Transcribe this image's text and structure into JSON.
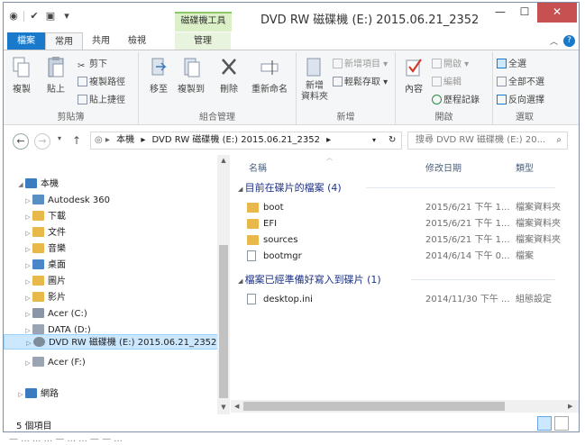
{
  "window": {
    "title": "DVD RW 磁碟機 (E:) 2015.06.21_2352",
    "context_tab_header": "磁碟機工具",
    "controls": {
      "minimize": "—",
      "maximize": "☐",
      "close": "✕"
    }
  },
  "ribbon_tabs": [
    {
      "label": "檔案"
    },
    {
      "label": "常用"
    },
    {
      "label": "共用"
    },
    {
      "label": "檢視"
    },
    {
      "label": "管理"
    }
  ],
  "ribbon": {
    "groups": {
      "clipboard": {
        "label": "剪貼簿",
        "copy": "複製",
        "paste": "貼上",
        "cut": "剪下",
        "copy_path": "複製路徑",
        "paste_shortcut": "貼上捷徑"
      },
      "organize": {
        "label": "組合管理",
        "move_to": "移至",
        "copy_to": "複製到",
        "delete": "刪除",
        "rename": "重新命名"
      },
      "new": {
        "label": "新增",
        "new_folder": "新增\n資料夾",
        "new_item": "新增項目 ▾",
        "easy_access": "輕鬆存取 ▾"
      },
      "open": {
        "label": "開啟",
        "properties": "內容",
        "open": "開啟 ▾",
        "edit": "編輯",
        "history": "歷程記錄"
      },
      "select": {
        "label": "選取",
        "select_all": "全選",
        "select_none": "全部不選",
        "invert": "反向選擇"
      }
    }
  },
  "address": {
    "segments": [
      "本機",
      "DVD RW 磁碟機 (E:) 2015.06.21_2352"
    ],
    "search_placeholder": "搜尋 DVD RW 磁碟機 (E:) 20..."
  },
  "nav_tree": [
    {
      "label": "本機",
      "icon": "computer-icon",
      "level": 0,
      "expander": "◢"
    },
    {
      "label": "Autodesk 360",
      "icon": "cloud-icon",
      "level": 1,
      "expander": "▷"
    },
    {
      "label": "下載",
      "icon": "download-folder-icon",
      "level": 1,
      "expander": "▷"
    },
    {
      "label": "文件",
      "icon": "documents-folder-icon",
      "level": 1,
      "expander": "▷"
    },
    {
      "label": "音樂",
      "icon": "music-folder-icon",
      "level": 1,
      "expander": "▷"
    },
    {
      "label": "桌面",
      "icon": "desktop-folder-icon",
      "level": 1,
      "expander": "▷"
    },
    {
      "label": "圖片",
      "icon": "pictures-folder-icon",
      "level": 1,
      "expander": "▷"
    },
    {
      "label": "影片",
      "icon": "videos-folder-icon",
      "level": 1,
      "expander": "▷"
    },
    {
      "label": "Acer (C:)",
      "icon": "windows-drive-icon",
      "level": 1,
      "expander": "▷"
    },
    {
      "label": "DATA (D:)",
      "icon": "drive-icon",
      "level": 1,
      "expander": "▷"
    },
    {
      "label": "DVD RW 磁碟機 (E:) 2015.06.21_2352",
      "icon": "dvd-drive-icon",
      "level": 1,
      "expander": "▷",
      "selected": true
    },
    {
      "label": "Acer (F:)",
      "icon": "drive-icon",
      "level": 1,
      "expander": "▷"
    },
    {
      "label": "網路",
      "icon": "network-icon",
      "level": 0,
      "expander": "▷"
    }
  ],
  "columns": {
    "name": "名稱",
    "date": "修改日期",
    "type": "類型"
  },
  "groups": [
    {
      "title": "目前在碟片的檔案 (4)",
      "rows": [
        {
          "name": "boot",
          "date": "2015/6/21 下午 1...",
          "type": "檔案資料夾",
          "icon": "folder-icon"
        },
        {
          "name": "EFI",
          "date": "2015/6/21 下午 1...",
          "type": "檔案資料夾",
          "icon": "folder-icon"
        },
        {
          "name": "sources",
          "date": "2015/6/21 下午 1...",
          "type": "檔案資料夾",
          "icon": "folder-icon"
        },
        {
          "name": "bootmgr",
          "date": "2014/6/14 下午 0...",
          "type": "檔案",
          "icon": "file-icon"
        }
      ]
    },
    {
      "title": "檔案已經準備好寫入到碟片 (1)",
      "rows": [
        {
          "name": "desktop.ini",
          "date": "2014/11/30 下午 ...",
          "type": "組態設定",
          "icon": "settings-file-icon"
        }
      ]
    }
  ],
  "status": {
    "item_count": "5 個項目"
  },
  "below_window_text": "— ... ... ... — ... ... — — ..."
}
